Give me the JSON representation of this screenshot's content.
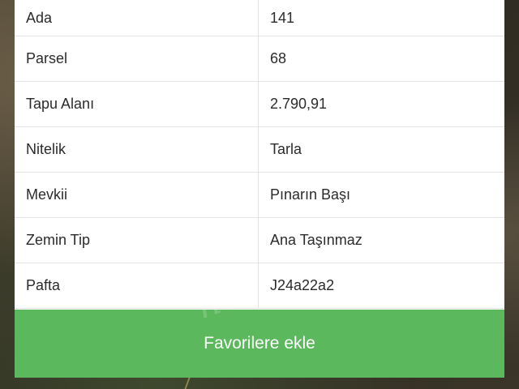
{
  "rows": [
    {
      "key": "Ada",
      "value": "141"
    },
    {
      "key": "Parsel",
      "value": "68"
    },
    {
      "key": "Tapu Alanı",
      "value": "2.790,91"
    },
    {
      "key": "Nitelik",
      "value": "Tarla"
    },
    {
      "key": "Mevkii",
      "value": "Pınarın Başı"
    },
    {
      "key": "Zemin Tip",
      "value": "Ana Taşınmaz"
    },
    {
      "key": "Pafta",
      "value": "J24a22a2"
    }
  ],
  "favorite_button": {
    "label": "Favorilere ekle",
    "color": "#5cb85c"
  }
}
